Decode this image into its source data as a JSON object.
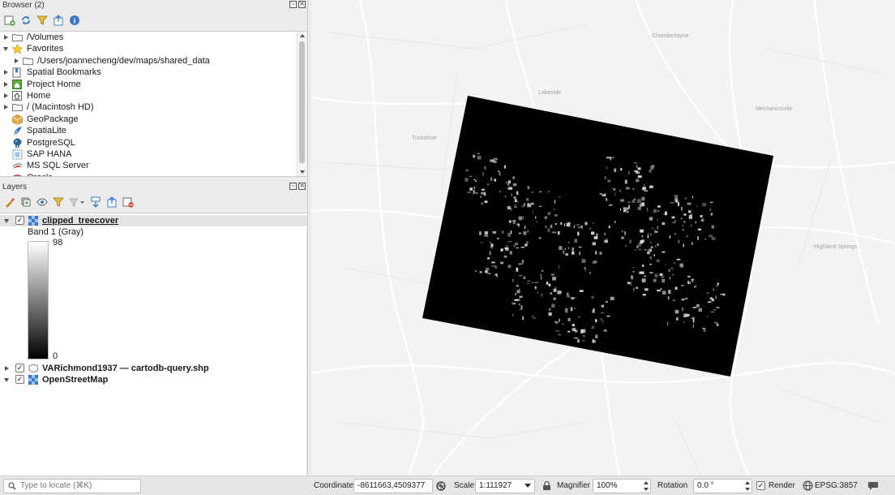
{
  "browser": {
    "title": "Browser (2)",
    "toolbar_icons": [
      "add-layer-icon",
      "refresh-icon",
      "filter-icon",
      "collapse-all-icon",
      "info-icon"
    ],
    "items": [
      {
        "label": "/Volumes",
        "icon": "folder-icon",
        "expanded": false,
        "indent": 0
      },
      {
        "label": "Favorites",
        "icon": "star-icon",
        "expanded": true,
        "indent": 0
      },
      {
        "label": "/Users/joannecheng/dev/maps/shared_data",
        "icon": "folder-icon",
        "expanded": false,
        "indent": 1
      },
      {
        "label": "Spatial Bookmarks",
        "icon": "bookmark-icon",
        "expanded": false,
        "indent": 0
      },
      {
        "label": "Project Home",
        "icon": "project-home-icon",
        "expanded": false,
        "indent": 0
      },
      {
        "label": "Home",
        "icon": "home-icon",
        "expanded": false,
        "indent": 0
      },
      {
        "label": "/ (Macintosh HD)",
        "icon": "folder-icon",
        "expanded": false,
        "indent": 0
      },
      {
        "label": "GeoPackage",
        "icon": "geopackage-icon",
        "expanded": null,
        "indent": 0
      },
      {
        "label": "SpatiaLite",
        "icon": "spatialite-icon",
        "expanded": null,
        "indent": 0
      },
      {
        "label": "PostgreSQL",
        "icon": "postgresql-icon",
        "expanded": null,
        "indent": 0
      },
      {
        "label": "SAP HANA",
        "icon": "sap-hana-icon",
        "expanded": null,
        "indent": 0
      },
      {
        "label": "MS SQL Server",
        "icon": "mssql-icon",
        "expanded": null,
        "indent": 0
      },
      {
        "label": "Oracle",
        "icon": "oracle-icon",
        "expanded": null,
        "indent": 0
      }
    ]
  },
  "layers": {
    "title": "Layers",
    "toolbar_icons": [
      "style-icon",
      "add-group-icon",
      "visibility-icon",
      "filter-legend-icon",
      "filter-expression-icon",
      "expand-all-icon",
      "collapse-all-icon",
      "remove-layer-icon"
    ],
    "items": [
      {
        "name": "clipped_treecover",
        "checked": true,
        "expanded": true,
        "icon": "raster-icon",
        "selected": true
      },
      {
        "name": "VARichmond1937 — cartodb-query.shp",
        "checked": true,
        "expanded": false,
        "icon": "vector-icon",
        "selected": false
      },
      {
        "name": "OpenStreetMap",
        "checked": true,
        "expanded": true,
        "icon": "raster-icon",
        "selected": false
      }
    ],
    "legend": {
      "band_label": "Band 1 (Gray)",
      "max": "98",
      "min": "0"
    }
  },
  "statusbar": {
    "locate_placeholder": "Type to locate (⌘K)",
    "coordinate_label": "Coordinate",
    "coordinate_value": "-8611663,4509377",
    "scale_label": "Scale",
    "scale_value": "1:111927",
    "magnifier_label": "Magnifier",
    "magnifier_value": "100%",
    "rotation_label": "Rotation",
    "rotation_value": "0.0 °",
    "render_label": "Render",
    "render_checked": true,
    "crs_label": "EPSG:3857"
  },
  "map": {
    "place_labels": [
      "Chamberlayne",
      "Lakeside",
      "Tuckahoe",
      "Mechanicsville",
      "Highland Springs"
    ]
  },
  "colors": {
    "accent": "#2b6fd6",
    "selection": "#e3e3e3"
  }
}
